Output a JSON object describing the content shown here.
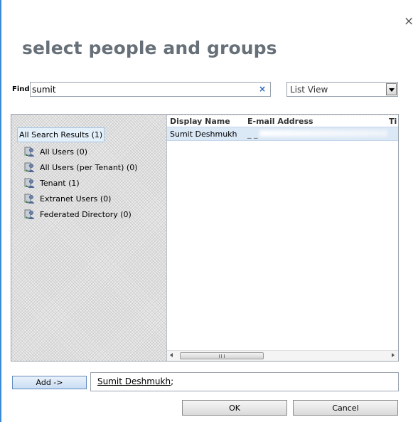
{
  "dialog": {
    "title": "select people and groups",
    "close_glyph": "×"
  },
  "find": {
    "label": "Find",
    "value": "sumit",
    "clear_glyph": "×"
  },
  "view_selector": {
    "selected": "List View"
  },
  "tree": {
    "root": "All Search Results (1)",
    "items": [
      {
        "label": "All Users (0)",
        "icon": "user-directory-icon"
      },
      {
        "label": "All Users (per Tenant) (0)",
        "icon": "user-directory-icon"
      },
      {
        "label": "Tenant (1)",
        "icon": "user-directory-icon"
      },
      {
        "label": "Extranet Users (0)",
        "icon": "user-directory-icon"
      },
      {
        "label": "Federated Directory (0)",
        "icon": "user-directory-icon"
      }
    ]
  },
  "results": {
    "columns": [
      "Display Name",
      "E-mail Address",
      "Ti"
    ],
    "rows": [
      {
        "display_name": "Sumit Deshmukh",
        "email": "_ _"
      }
    ],
    "scroll_grip": "III"
  },
  "actions": {
    "add_label": "Add ->",
    "selected_name": "Sumit Deshmukh",
    "selected_separator": ";",
    "ok_label": "OK",
    "cancel_label": "Cancel"
  },
  "colors": {
    "accent": "#3a8ad8",
    "title": "#677078",
    "selected_row": "#dbe8f6"
  }
}
